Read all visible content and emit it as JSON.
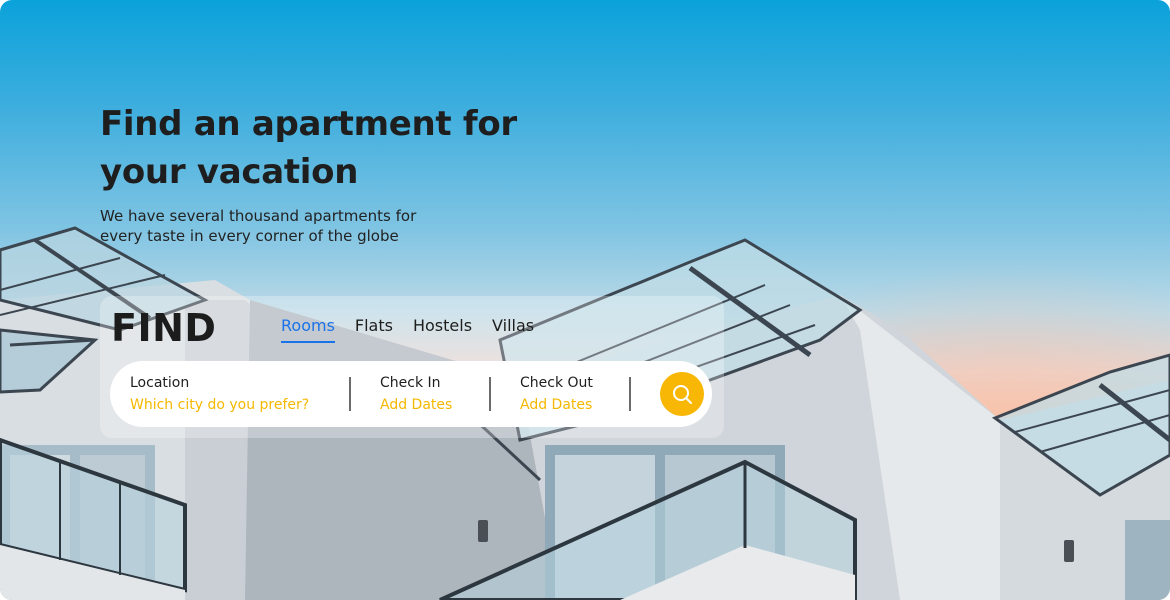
{
  "hero": {
    "headline": "Find an apartment for your vacation",
    "subtitle": "We have several thousand apartments for every taste in every corner of the globe"
  },
  "search": {
    "find_label": "FIND",
    "tabs": [
      {
        "label": "Rooms",
        "active": true
      },
      {
        "label": "Flats",
        "active": false
      },
      {
        "label": "Hostels",
        "active": false
      },
      {
        "label": "Villas",
        "active": false
      }
    ],
    "location": {
      "label": "Location",
      "placeholder": "Which city do you prefer?"
    },
    "check_in": {
      "label": "Check In",
      "placeholder": "Add Dates"
    },
    "check_out": {
      "label": "Check Out",
      "placeholder": "Add Dates"
    },
    "search_icon": "search-icon"
  },
  "colors": {
    "accent_blue": "#1a73e8",
    "accent_yellow": "#f8b705",
    "text_dark": "#1e1e1e"
  }
}
